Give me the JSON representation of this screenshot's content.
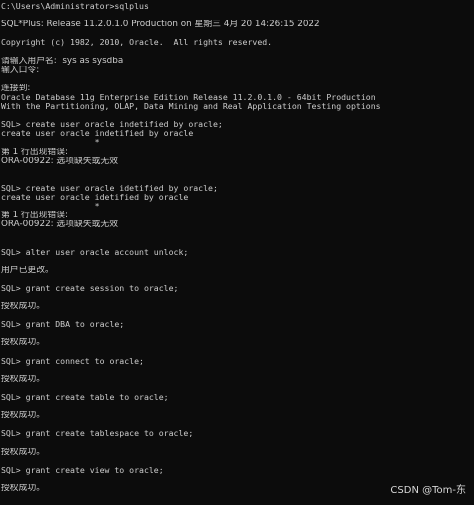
{
  "console": {
    "lines": [
      "C:\\Users\\Administrator>sqlplus",
      "",
      "SQL*Plus: Release 11.2.0.1.0 Production on 星期三 4月 20 14:26:15 2022",
      "",
      "Copyright (c) 1982, 2010, Oracle.  All rights reserved.",
      "",
      "请输入用户名:  sys as sysdba",
      "输入口令:",
      "",
      "连接到:",
      "Oracle Database 11g Enterprise Edition Release 11.2.0.1.0 - 64bit Production",
      "With the Partitioning, OLAP, Data Mining and Real Application Testing options",
      "",
      "SQL> create user oracle indetified by oracle;",
      "create user oracle indetified by oracle",
      "                   *",
      "第 1 行出现错误:",
      "ORA-00922: 选项缺失或无效",
      "",
      "",
      "SQL> create user oracle idetified by oracle;",
      "create user oracle idetified by oracle",
      "                   *",
      "第 1 行出现错误:",
      "ORA-00922: 选项缺失或无效",
      "",
      "",
      "SQL> alter user oracle account unlock;",
      "",
      "用户已更改。",
      "",
      "SQL> grant create session to oracle;",
      "",
      "授权成功。",
      "",
      "SQL> grant DBA to oracle;",
      "",
      "授权成功。",
      "",
      "SQL> grant connect to oracle;",
      "",
      "授权成功。",
      "",
      "SQL> grant create table to oracle;",
      "",
      "授权成功。",
      "",
      "SQL> grant create tablespace to oracle;",
      "",
      "授权成功。",
      "",
      "SQL> grant create view to oracle;",
      "",
      "授权成功。"
    ]
  },
  "watermark": {
    "text": "CSDN @Tom-东"
  },
  "colors": {
    "background": "#0c0c0c",
    "text": "#cccccc"
  }
}
